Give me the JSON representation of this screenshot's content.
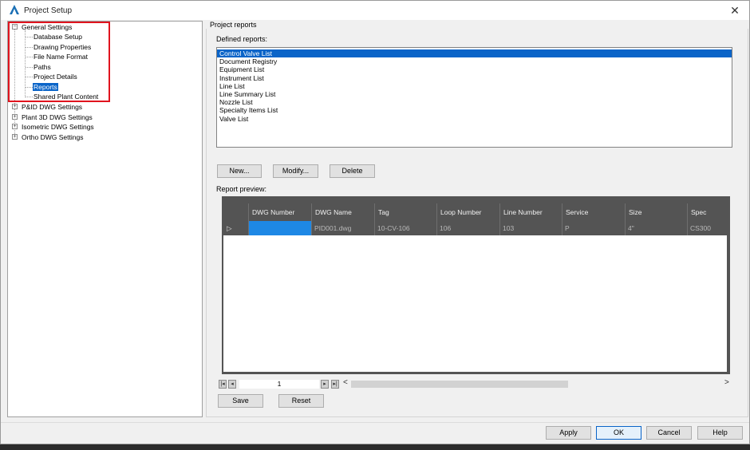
{
  "window": {
    "title": "Project Setup",
    "close_glyph": "✕"
  },
  "tree": {
    "root": {
      "label": "General Settings",
      "toggle": "−"
    },
    "children": [
      {
        "label": "Database Setup"
      },
      {
        "label": "Drawing Properties"
      },
      {
        "label": "File Name Format"
      },
      {
        "label": "Paths"
      },
      {
        "label": "Project Details"
      },
      {
        "label": "Reports"
      },
      {
        "label": "Shared Plant Content"
      }
    ],
    "collapsed": [
      {
        "label": "P&ID DWG Settings",
        "toggle": "+"
      },
      {
        "label": "Plant 3D DWG Settings",
        "toggle": "+"
      },
      {
        "label": "Isometric DWG Settings",
        "toggle": "+"
      },
      {
        "label": "Ortho DWG Settings",
        "toggle": "+"
      }
    ]
  },
  "panel": {
    "group_title": "Project reports",
    "defined_label": "Defined reports:",
    "reports": [
      "Control Valve List",
      "Document Registry",
      "Equipment List",
      "Instrument List",
      "Line List",
      "Line Summary List",
      "Nozzle List",
      "Specialty Items List",
      "Valve List"
    ],
    "buttons": {
      "new": "New...",
      "modify": "Modify...",
      "delete": "Delete"
    },
    "preview_label": "Report preview:"
  },
  "grid": {
    "columns": [
      "DWG Number",
      "DWG Name",
      "Tag",
      "Loop Number",
      "Line Number",
      "Service",
      "Size",
      "Spec"
    ],
    "row": {
      "indicator": "▷",
      "cells": [
        "",
        "PID001.dwg",
        "10-CV-106",
        "106",
        "103",
        "P",
        "4\"",
        "CS300"
      ]
    }
  },
  "pager": {
    "first": "|◂",
    "prev": "◂",
    "page": "1",
    "next": "▸",
    "last": "▸|",
    "scroll_left": "<",
    "scroll_right": ">"
  },
  "bottom_buttons": {
    "save": "Save",
    "reset": "Reset"
  },
  "dialog_buttons": {
    "apply": "Apply",
    "ok": "OK",
    "cancel": "Cancel",
    "help": "Help"
  }
}
